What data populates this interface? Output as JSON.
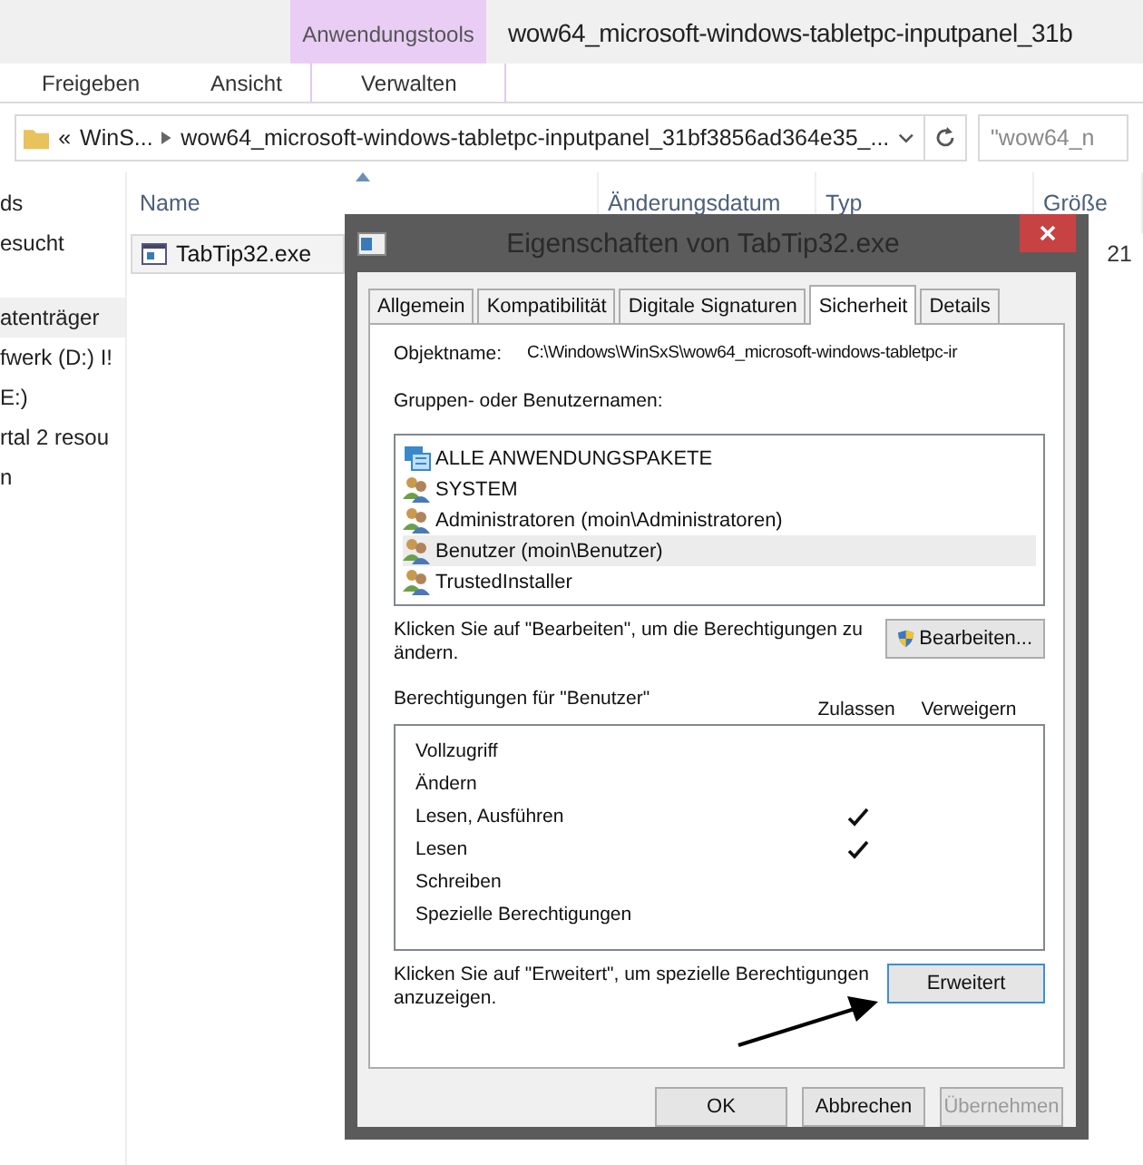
{
  "explorer": {
    "context_tab": "Anwendungstools",
    "window_title": "wow64_microsoft-windows-tabletpc-inputpanel_31b",
    "ribbon_tabs": [
      {
        "label": "Freigeben",
        "kind": "plain"
      },
      {
        "label": "Ansicht",
        "kind": "plain"
      },
      {
        "label": "Verwalten",
        "kind": "context"
      }
    ],
    "address": {
      "overflow": "«",
      "crumbs": [
        "WinS...",
        "wow64_microsoft-windows-tabletpc-inputpanel_31bf3856ad364e35_..."
      ]
    },
    "search": {
      "placeholder": "\"wow64_n"
    },
    "nav_items": [
      {
        "label": "ds",
        "kind": "item"
      },
      {
        "label": "esucht",
        "kind": "item"
      },
      {
        "label": "atenträger",
        "kind": "header"
      },
      {
        "label": "fwerk (D:) I!",
        "kind": "item"
      },
      {
        "label": "E:)",
        "kind": "item"
      },
      {
        "label": "rtal 2 resou",
        "kind": "item"
      },
      {
        "label": "n",
        "kind": "item"
      }
    ],
    "columns": [
      "Name",
      "Änderungsdatum",
      "Typ",
      "Größe"
    ],
    "files": [
      {
        "name": "TabTip32.exe",
        "size": "21"
      }
    ]
  },
  "dialog": {
    "title": "Eigenschaften von TabTip32.exe",
    "tabs": [
      {
        "label": "Allgemein",
        "selected": false
      },
      {
        "label": "Kompatibilität",
        "selected": false
      },
      {
        "label": "Digitale Signaturen",
        "selected": false
      },
      {
        "label": "Sicherheit",
        "selected": true
      },
      {
        "label": "Details",
        "selected": false
      }
    ],
    "object_label": "Objektname:",
    "object_path": "C:\\Windows\\WinSxS\\wow64_microsoft-windows-tabletpc-ir",
    "groups_label": "Gruppen- oder Benutzernamen:",
    "users": [
      {
        "name": "ALLE ANWENDUNGSPAKETE",
        "kind": "package",
        "selected": false
      },
      {
        "name": "SYSTEM",
        "kind": "group",
        "selected": false
      },
      {
        "name": "Administratoren (moin\\Administratoren)",
        "kind": "group",
        "selected": false
      },
      {
        "name": "Benutzer (moin\\Benutzer)",
        "kind": "group",
        "selected": true
      },
      {
        "name": "TrustedInstaller",
        "kind": "group",
        "selected": false
      }
    ],
    "edit_hint": "Klicken Sie auf \"Bearbeiten\", um die Berechtigungen zu ändern.",
    "edit_button": "Bearbeiten...",
    "permissions_label": "Berechtigungen für \"Benutzer\"",
    "permission_columns": [
      "Zulassen",
      "Verweigern"
    ],
    "permissions": [
      {
        "name": "Vollzugriff",
        "allow": false,
        "deny": false
      },
      {
        "name": "Ändern",
        "allow": false,
        "deny": false
      },
      {
        "name": "Lesen, Ausführen",
        "allow": true,
        "deny": false
      },
      {
        "name": "Lesen",
        "allow": true,
        "deny": false
      },
      {
        "name": "Schreiben",
        "allow": false,
        "deny": false
      },
      {
        "name": "Spezielle Berechtigungen",
        "allow": false,
        "deny": false
      }
    ],
    "advanced_hint": "Klicken Sie auf \"Erweitert\", um spezielle Berechtigungen anzuzeigen.",
    "advanced_button": "Erweitert",
    "buttons": [
      {
        "label": "OK",
        "disabled": false
      },
      {
        "label": "Abbrechen",
        "disabled": false
      },
      {
        "label": "Übernehmen",
        "disabled": true
      }
    ]
  }
}
